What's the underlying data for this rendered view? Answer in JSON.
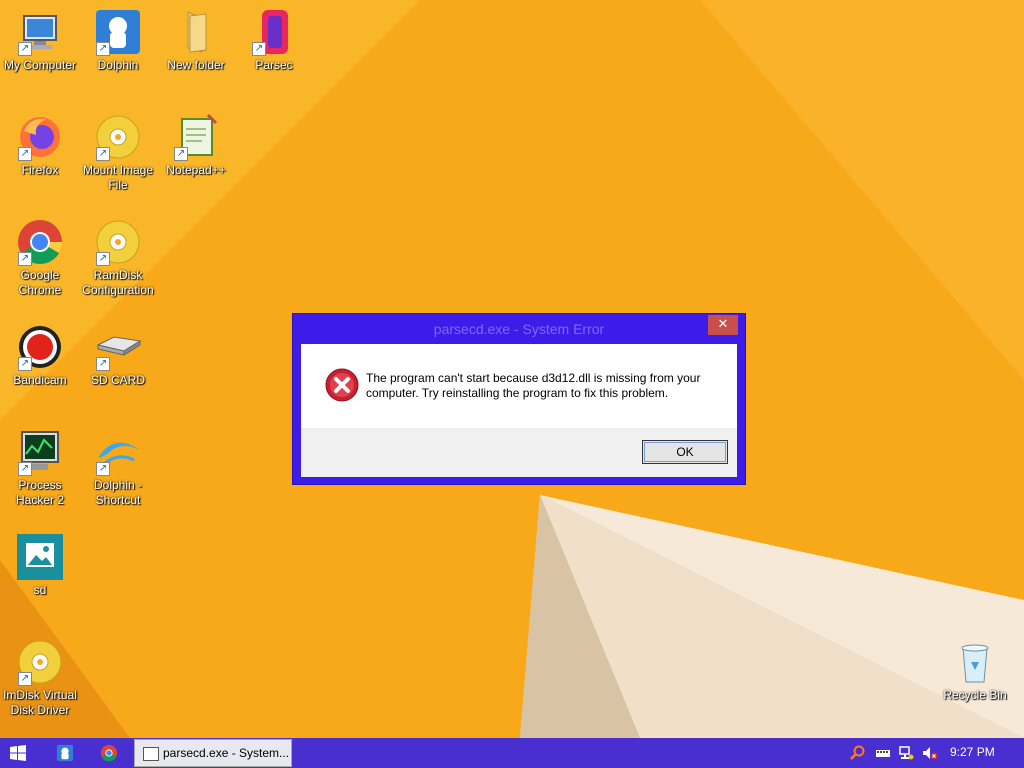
{
  "desktop": {
    "icons": [
      {
        "id": "my-computer",
        "label": "My Computer",
        "icon": "computer-icon"
      },
      {
        "id": "dolphin",
        "label": "Dolphin",
        "icon": "dolphin-icon"
      },
      {
        "id": "new-folder",
        "label": "New folder",
        "icon": "folder-icon"
      },
      {
        "id": "parsec",
        "label": "Parsec",
        "icon": "parsec-icon"
      },
      {
        "id": "firefox",
        "label": "Firefox",
        "icon": "firefox-icon"
      },
      {
        "id": "mount-image",
        "label": "Mount Image File",
        "icon": "disc-icon"
      },
      {
        "id": "notepad",
        "label": "Notepad++",
        "icon": "notepad-icon"
      },
      {
        "id": "chrome",
        "label": "Google Chrome",
        "icon": "chrome-icon"
      },
      {
        "id": "ramdisk",
        "label": "RamDisk Configuration",
        "icon": "disc-icon"
      },
      {
        "id": "bandicam",
        "label": "Bandicam",
        "icon": "bandicam-icon"
      },
      {
        "id": "sd-card",
        "label": "SD CARD",
        "icon": "drive-icon"
      },
      {
        "id": "process-hacker",
        "label": "Process Hacker 2",
        "icon": "monitor-icon"
      },
      {
        "id": "dolphin-shortcut",
        "label": "Dolphin - Shortcut",
        "icon": "dolphin-logo-icon"
      },
      {
        "id": "sd",
        "label": "sd",
        "icon": "image-icon"
      },
      {
        "id": "imdisk",
        "label": "ImDisk Virtual Disk Driver",
        "icon": "disc-icon"
      },
      {
        "id": "recycle-bin",
        "label": "Recycle Bin",
        "icon": "recycle-bin-icon"
      }
    ]
  },
  "dialog": {
    "title": "parsecd.exe - System Error",
    "close_label": "✕",
    "message": "The program can't start because d3d12.dll is missing from your computer. Try reinstalling the program to fix this problem.",
    "ok_label": "OK",
    "icon": "error-icon"
  },
  "taskbar": {
    "app_window_label": "parsecd.exe - System...",
    "clock": "9:27 PM",
    "colors": {
      "taskbar": "#4a2fd0",
      "dialog_frame": "#3d1be8",
      "close": "#c7504d"
    }
  }
}
